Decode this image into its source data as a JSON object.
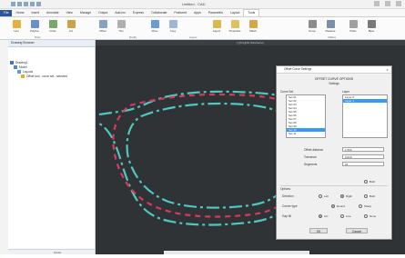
{
  "window": {
    "title": "Untitled - CAD"
  },
  "tabs": [
    "File",
    "Home",
    "Insert",
    "Annotate",
    "View",
    "Manage",
    "Output",
    "Add-ins",
    "Express",
    "Collaborate",
    "Featured",
    "Apps",
    "Parametric",
    "Layout",
    "Tools"
  ],
  "ribbon": {
    "buttons": [
      "Line",
      "Polyline",
      "Circle",
      "Arc",
      "Offset",
      "Trim",
      "Move",
      "Copy",
      "Layers",
      "Properties",
      "Match",
      "Group",
      "Measure",
      "Paste",
      "Base"
    ],
    "group_labels": [
      "Draw",
      "Modify",
      "Layers",
      "Utilities"
    ]
  },
  "left_panel": {
    "header": "Drawing Browser",
    "tree": [
      "Drawing1",
      "Model",
      "Layouts",
      "Offset tool - curve set - selected"
    ],
    "status": "Model"
  },
  "canvas": {
    "top_label": "[-][Top][2D Wireframe]"
  },
  "dialog": {
    "title": "Offset Curve Settings",
    "heading": "OFFSET CURVE OPTIONS",
    "subheading": "Settings",
    "list_label": "Curve Set",
    "list_items": [
      "Set 01",
      "Set 02",
      "Set 03",
      "Set 04",
      "Set 05",
      "Set 06",
      "Set 07",
      "Set 08",
      "Set 09",
      "Set 10",
      "Set 11"
    ],
    "selected_index": 9,
    "right_list_label": "Layer",
    "right_list_items": [
      "Layer 0",
      "Layer 1"
    ],
    "right_selected_index": 1,
    "fields": [
      {
        "label": "Offset distance",
        "value": "1.500"
      },
      {
        "label": "Tolerance",
        "value": "0.010"
      },
      {
        "label": "Segments",
        "value": "24"
      }
    ],
    "checkbox_label": "Both",
    "section_label": "Options",
    "radio_rows": [
      {
        "label": "Direction",
        "options": [
          "Left",
          "Right",
          "Both"
        ],
        "selected": 1
      },
      {
        "label": "Corner type",
        "options": [
          "Round",
          "Sharp"
        ],
        "selected": 0
      },
      {
        "label": "Gap fill",
        "options": [
          "Arc",
          "Line",
          "None"
        ],
        "selected": 0
      }
    ],
    "ok_label": "OK",
    "cancel_label": "Cancel"
  },
  "colors": {
    "canvas_bg": "#2f3336",
    "curve_teal": "#4fc9c0",
    "curve_red": "#d83a5e",
    "file_tab": "#2b579a",
    "selection": "#3399ff"
  }
}
